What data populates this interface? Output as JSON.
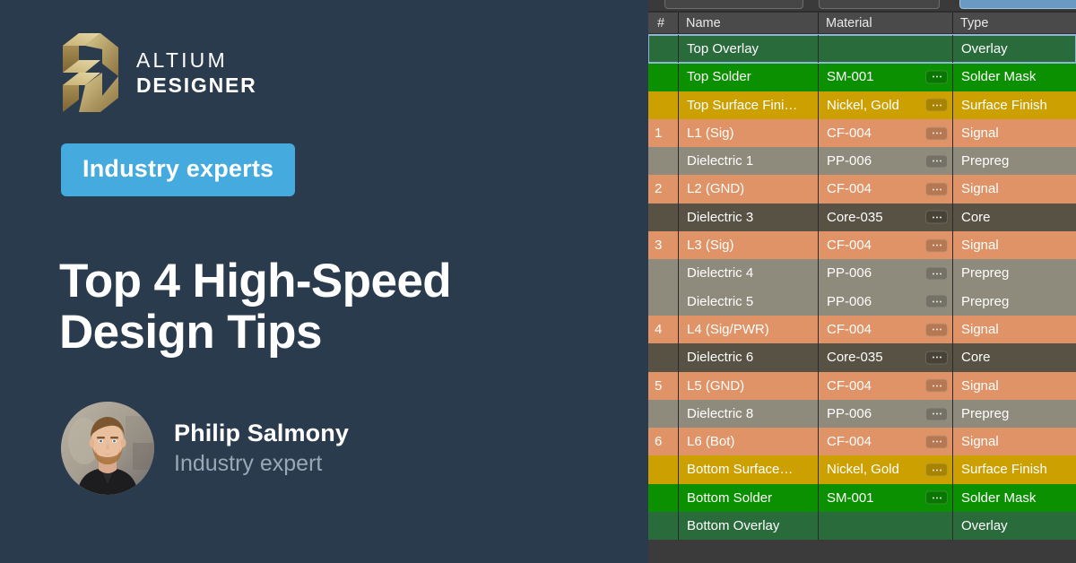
{
  "brand": {
    "logo_icon": "altium-logo-mark",
    "name_line1": "ALTIUM",
    "name_line2": "DESIGNER"
  },
  "badge": {
    "label": "Industry experts"
  },
  "title": {
    "line1": "Top 4 High-Speed",
    "line2": "Design Tips"
  },
  "author": {
    "avatar_icon": "avatar-photo",
    "name": "Philip Salmony",
    "role": "Industry expert"
  },
  "colors": {
    "background": "#2b3b4e",
    "badge": "#45AADD",
    "title_text": "#ffffff",
    "role_text": "#9aa7b4",
    "app_background": "#3b3b3b",
    "header_background": "#4a4a4a",
    "row_overlay": "#2a6b3c",
    "row_solder_mask": "#0a9000",
    "row_surface_finish": "#cca000",
    "row_signal": "#df9366",
    "row_prepreg": "#8e8b7c",
    "row_core": "#585244",
    "selection_border": "#8fb4d6",
    "toolbar_highlight": "#6a9ac4"
  },
  "app": {
    "toolbar": {
      "button_1_label": "",
      "button_2_label": "",
      "button_3_label": ""
    },
    "table": {
      "columns": [
        "#",
        "Name",
        "Material",
        "Type"
      ],
      "material_button_icon": "ellipsis-icon",
      "rows": [
        {
          "num": "",
          "name": "Top Overlay",
          "material": "",
          "type": "Overlay",
          "style": "r-overlay",
          "has_material_button": false,
          "selected": true
        },
        {
          "num": "",
          "name": "Top Solder",
          "material": "SM-001",
          "type": "Solder Mask",
          "style": "r-solder",
          "has_material_button": true,
          "selected": false
        },
        {
          "num": "",
          "name": "Top Surface Fini…",
          "material": "Nickel, Gold",
          "type": "Surface Finish",
          "style": "r-surface",
          "has_material_button": true,
          "selected": false
        },
        {
          "num": "1",
          "name": "L1 (Sig)",
          "material": "CF-004",
          "type": "Signal",
          "style": "r-signal",
          "has_material_button": true,
          "selected": false
        },
        {
          "num": "",
          "name": "Dielectric 1",
          "material": "PP-006",
          "type": "Prepreg",
          "style": "r-prepreg",
          "has_material_button": true,
          "selected": false
        },
        {
          "num": "2",
          "name": "L2 (GND)",
          "material": "CF-004",
          "type": "Signal",
          "style": "r-signal",
          "has_material_button": true,
          "selected": false
        },
        {
          "num": "",
          "name": "Dielectric 3",
          "material": "Core-035",
          "type": "Core",
          "style": "r-core",
          "has_material_button": true,
          "selected": false
        },
        {
          "num": "3",
          "name": "L3 (Sig)",
          "material": "CF-004",
          "type": "Signal",
          "style": "r-signal",
          "has_material_button": true,
          "selected": false
        },
        {
          "num": "",
          "name": "Dielectric 4",
          "material": "PP-006",
          "type": "Prepreg",
          "style": "r-prepreg",
          "has_material_button": true,
          "selected": false
        },
        {
          "num": "",
          "name": "Dielectric 5",
          "material": "PP-006",
          "type": "Prepreg",
          "style": "r-prepreg",
          "has_material_button": true,
          "selected": false
        },
        {
          "num": "4",
          "name": "L4 (Sig/PWR)",
          "material": "CF-004",
          "type": "Signal",
          "style": "r-signal",
          "has_material_button": true,
          "selected": false
        },
        {
          "num": "",
          "name": "Dielectric 6",
          "material": "Core-035",
          "type": "Core",
          "style": "r-core",
          "has_material_button": true,
          "selected": false
        },
        {
          "num": "5",
          "name": "L5 (GND)",
          "material": "CF-004",
          "type": "Signal",
          "style": "r-signal",
          "has_material_button": true,
          "selected": false
        },
        {
          "num": "",
          "name": "Dielectric 8",
          "material": "PP-006",
          "type": "Prepreg",
          "style": "r-prepreg",
          "has_material_button": true,
          "selected": false
        },
        {
          "num": "6",
          "name": "L6 (Bot)",
          "material": "CF-004",
          "type": "Signal",
          "style": "r-signal",
          "has_material_button": true,
          "selected": false
        },
        {
          "num": "",
          "name": "Bottom Surface…",
          "material": "Nickel, Gold",
          "type": "Surface Finish",
          "style": "r-surface",
          "has_material_button": true,
          "selected": false
        },
        {
          "num": "",
          "name": "Bottom Solder",
          "material": "SM-001",
          "type": "Solder Mask",
          "style": "r-solder",
          "has_material_button": true,
          "selected": false
        },
        {
          "num": "",
          "name": "Bottom Overlay",
          "material": "",
          "type": "Overlay",
          "style": "r-overlay",
          "has_material_button": false,
          "selected": false
        }
      ]
    }
  }
}
